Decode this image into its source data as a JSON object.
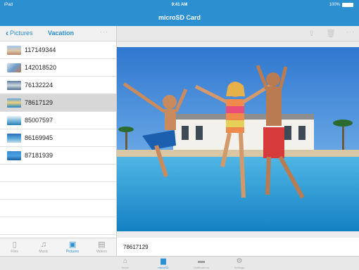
{
  "status_bar": {
    "carrier": "iPad",
    "time": "9:41 AM",
    "battery": "100%"
  },
  "title": "microSD Card",
  "left_nav": {
    "back_label": "Pictures",
    "folder": "Vacation",
    "more": "···"
  },
  "files": [
    {
      "name": "117149344"
    },
    {
      "name": "142018520"
    },
    {
      "name": "76132224"
    },
    {
      "name": "78617129",
      "selected": true
    },
    {
      "name": "85007597"
    },
    {
      "name": "86169945"
    },
    {
      "name": "87181939"
    }
  ],
  "left_tabs": [
    {
      "label": "Files",
      "icon": "file-icon"
    },
    {
      "label": "Music",
      "icon": "music-icon"
    },
    {
      "label": "Pictures",
      "icon": "pictures-icon",
      "active": true
    },
    {
      "label": "Videos",
      "icon": "video-icon"
    }
  ],
  "preview": {
    "caption": "78617129",
    "more": "···"
  },
  "bottom_tabs": [
    {
      "label": "Home",
      "icon": "home-icon"
    },
    {
      "label": "microSD",
      "icon": "sd-card-icon",
      "active": true
    },
    {
      "label": "Notifications",
      "icon": "chat-icon"
    },
    {
      "label": "Settings",
      "icon": "gear-icon"
    }
  ],
  "colors": {
    "accent": "#2b8fd0",
    "selected_row": "#d7d7d7"
  }
}
